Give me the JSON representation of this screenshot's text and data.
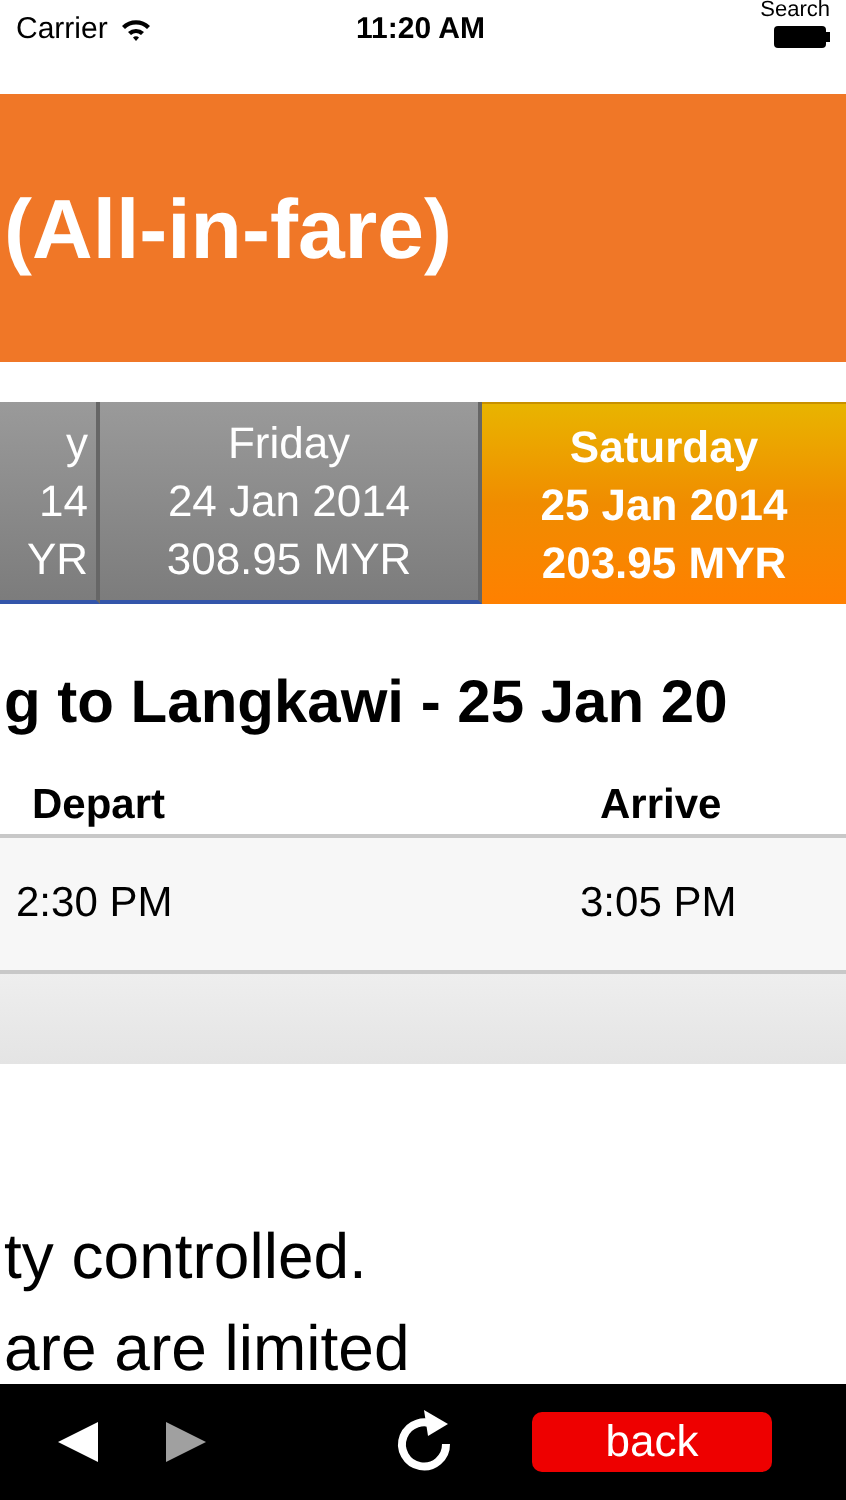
{
  "status_bar": {
    "carrier": "Carrier",
    "time": "11:20 AM",
    "overlay_text": "Search"
  },
  "header": {
    "title": "(All-in-fare)"
  },
  "date_tabs": [
    {
      "day": "y",
      "date": "14",
      "price": "YR",
      "selected": false
    },
    {
      "day": "Friday",
      "date": "24 Jan 2014",
      "price": "308.95 MYR",
      "selected": false
    },
    {
      "day": "Saturday",
      "date": "25 Jan 2014",
      "price": "203.95 MYR",
      "selected": true
    }
  ],
  "route_title": "g to Langkawi - 25 Jan 20",
  "table": {
    "columns": [
      "Depart",
      "Arrive"
    ],
    "rows": [
      [
        "2:30 PM",
        "3:05 PM"
      ]
    ]
  },
  "notes": [
    "ty controlled.",
    "are are limited"
  ],
  "toolbar": {
    "back_enabled": true,
    "forward_enabled": false,
    "button": "back"
  }
}
